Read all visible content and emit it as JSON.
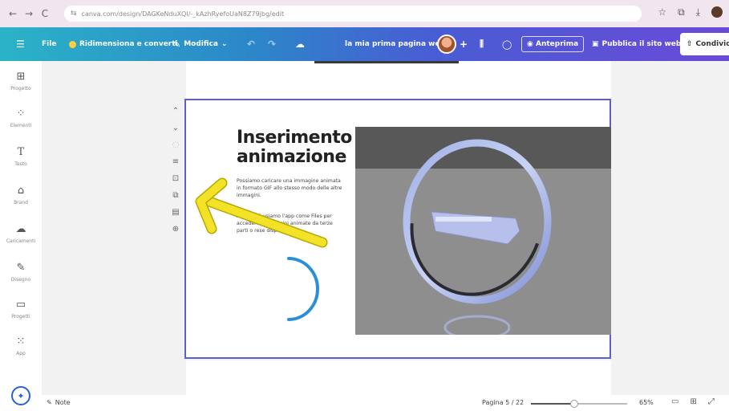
{
  "browser": {
    "url": "canva.com/design/DAGKeNduXQI/-_kAzhRyefoUaN8Z79jbg/edit",
    "nav": {
      "back": "←",
      "forward": "→",
      "reload": "C"
    },
    "site_info_icon": "⇆"
  },
  "toolbar": {
    "menu_icon": "☰",
    "file_label": "File",
    "resize_label": "Ridimensiona e converti",
    "edit_label": "Modifica",
    "design_title": "la mia prima pagina web",
    "plus_label": "+",
    "preview_label": "Anteprima",
    "publish_label": "Pubblica il sito web",
    "share_label": "Condividi"
  },
  "sidebar": {
    "items": [
      {
        "label": "Progetto",
        "icon": "⊞"
      },
      {
        "label": "Elementi",
        "icon": "⁘"
      },
      {
        "label": "Testo",
        "icon": "T"
      },
      {
        "label": "Brand",
        "icon": "⌂"
      },
      {
        "label": "Caricamenti",
        "icon": "☁"
      },
      {
        "label": "Disegno",
        "icon": "✎"
      },
      {
        "label": "Progetti",
        "icon": "▭"
      },
      {
        "label": "App",
        "icon": "⁙"
      }
    ]
  },
  "slide": {
    "title_line1": "Inserimento",
    "title_line2": "animazione",
    "paragraph1": "Possiamo caricare una immagine animata in formato GIF allo stesso modo delle altre immagini.",
    "paragraph2": "Altrimenti usiamo l'app come Files per accedere a immagini animate da terze parti o rese disponibili."
  },
  "bottom": {
    "notes_icon": "✎",
    "notes_label": "Note",
    "page_label": "Pagina 5 / 22",
    "zoom_progress": 0.45,
    "zoom_label": "65%"
  },
  "colors": {
    "accent": "#5b5fd0",
    "arrow": "#f2e228",
    "loader": "#2a8fd6"
  }
}
